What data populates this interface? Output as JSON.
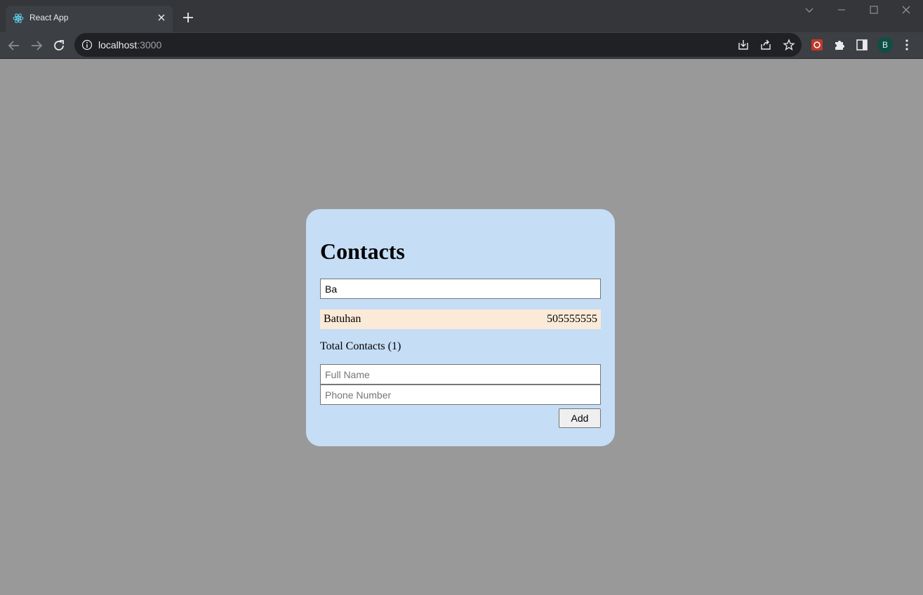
{
  "browser": {
    "tab_title": "React App",
    "url_host": "localhost",
    "url_port": ":3000",
    "profile_initial": "B"
  },
  "app": {
    "title": "Contacts",
    "filter_value": "Ba",
    "contacts": [
      {
        "name": "Batuhan",
        "phone": "505555555"
      }
    ],
    "total_label": "Total Contacts (1)",
    "fullname_placeholder": "Full Name",
    "phone_placeholder": "Phone Number",
    "add_label": "Add"
  },
  "colors": {
    "page_bg": "#999999",
    "card_bg": "#c5ddf5",
    "row_bg": "#fbead8"
  }
}
